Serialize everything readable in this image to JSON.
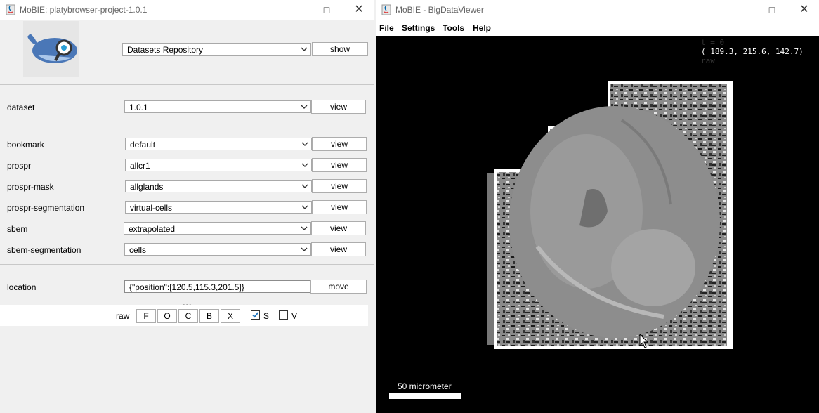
{
  "left_window": {
    "title": "MoBIE: platybrowser-project-1.0.1",
    "source": {
      "value": "Datasets Repository",
      "button": "show"
    },
    "dataset": {
      "label": "dataset",
      "value": "1.0.1",
      "button": "view"
    },
    "rows": [
      {
        "label": "bookmark",
        "value": "default",
        "button": "view"
      },
      {
        "label": "prospr",
        "value": "allcr1",
        "button": "view"
      },
      {
        "label": "prospr-mask",
        "value": "allglands",
        "button": "view"
      },
      {
        "label": "prospr-segmentation",
        "value": "virtual-cells",
        "button": "view"
      },
      {
        "label": "sbem",
        "value": "extrapolated",
        "button": "view"
      },
      {
        "label": "sbem-segmentation",
        "value": "cells",
        "button": "view"
      }
    ],
    "location": {
      "label": "location",
      "value": "{\"position\":[120.5,115.3,201.5]}",
      "button": "move"
    },
    "bottom_bar": {
      "source_label": "raw",
      "buttons": [
        "F",
        "O",
        "C",
        "B",
        "X"
      ],
      "checkbox_s": {
        "label": "S",
        "checked": true
      },
      "checkbox_v": {
        "label": "V",
        "checked": false
      }
    }
  },
  "right_window": {
    "title": "MoBIE - BigDataViewer",
    "menu": [
      "File",
      "Settings",
      "Tools",
      "Help"
    ],
    "overlay": {
      "time": "t = 0",
      "coords": "( 189.3, 215.6, 142.7)",
      "source": "raw"
    },
    "scale_bar": "50 micrometer"
  },
  "colors": {
    "checkbox_tick": "#1e73be",
    "viewer_bg": "#000000",
    "window_bg": "#f0f0f0"
  },
  "icons": [
    "java-icon",
    "minimize-icon",
    "maximize-icon",
    "close-icon",
    "chevron-down-icon",
    "checkmark-icon",
    "mouse-cursor-icon",
    "whale-logo-icon"
  ]
}
